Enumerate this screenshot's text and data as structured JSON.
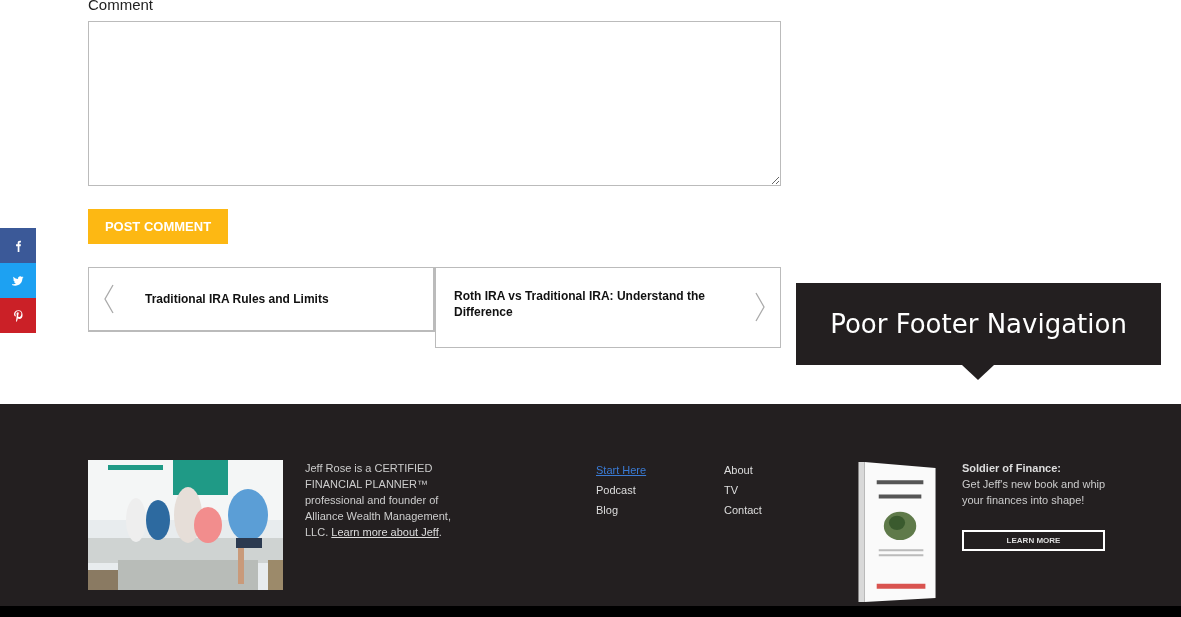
{
  "comment_form": {
    "label": "Comment",
    "submit": "POST COMMENT"
  },
  "share_buttons": [
    {
      "kind": "facebook",
      "color": "#3b5998"
    },
    {
      "kind": "twitter",
      "color": "#1da1f2"
    },
    {
      "kind": "pinterest",
      "color": "#cb2027"
    }
  ],
  "post_navigation": [
    {
      "kind": "previous",
      "title": "Traditional IRA Rules and Limits"
    },
    {
      "kind": "next",
      "title": "Roth IRA vs Traditional IRA: Understand the Difference"
    }
  ],
  "callout": {
    "text": "Poor Footer Navigation"
  },
  "footer": {
    "bio": "Jeff Rose is a CERTIFIED FINANCIAL PLANNER™ professional and founder of Alliance Wealth Management, LLC. ",
    "bio_link": "Learn more about Jeff",
    "bio_end": ".",
    "link_columns": [
      [
        {
          "label": "Start Here",
          "hovered": true
        },
        {
          "label": "Podcast",
          "hovered": false
        },
        {
          "label": "Blog",
          "hovered": false
        }
      ],
      [
        {
          "label": "About",
          "hovered": false
        },
        {
          "label": "TV",
          "hovered": false
        },
        {
          "label": "Contact",
          "hovered": false
        }
      ]
    ],
    "promo_title": "Soldier of Finance:",
    "promo_text": "Get Jeff's new book and whip your finances into shape!",
    "promo_button": "LEARN MORE"
  }
}
